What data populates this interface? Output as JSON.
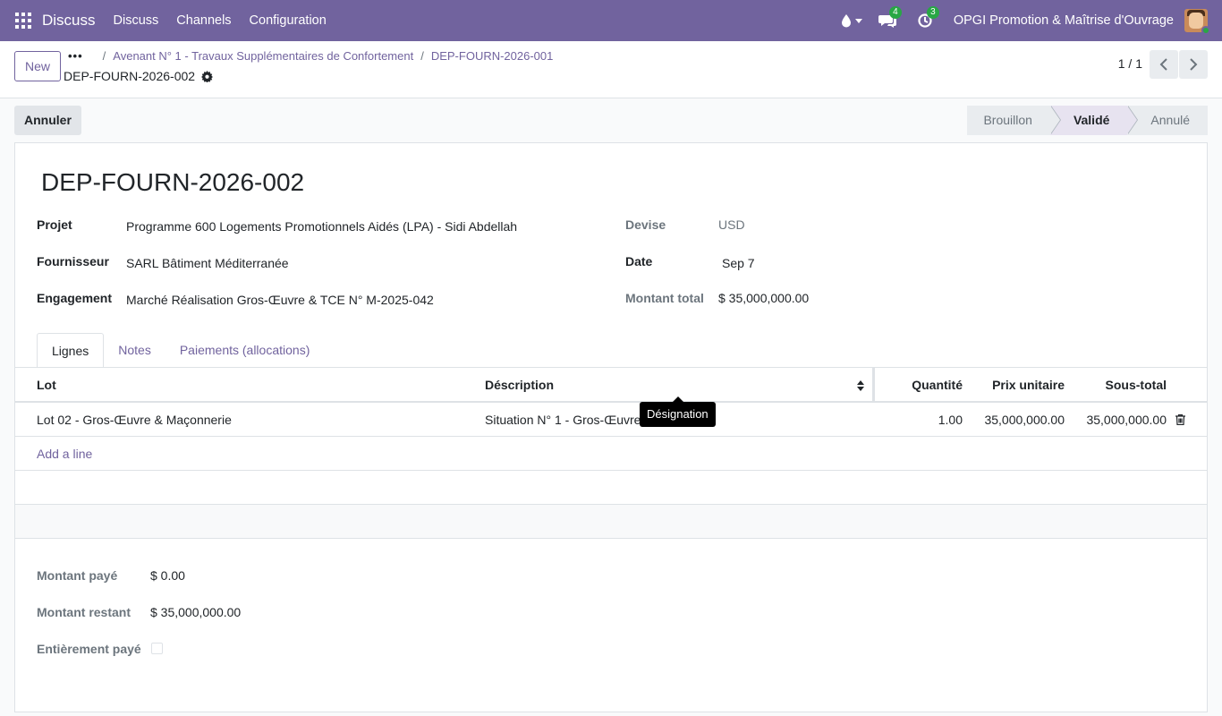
{
  "navbar": {
    "brand": "Discuss",
    "menu": [
      "Discuss",
      "Channels",
      "Configuration"
    ],
    "messages_badge": "4",
    "activities_badge": "3",
    "company": "OPGI Promotion & Maîtrise d'Ouvrage"
  },
  "control": {
    "new_label": "New",
    "breadcrumb": [
      "Avenant N° 1 - Travaux Supplémentaires de Confortement",
      "DEP-FOURN-2026-001"
    ],
    "record_name": "DEP-FOURN-2026-002",
    "pager": "1 / 1"
  },
  "statusbar": {
    "annuler_label": "Annuler",
    "stages": [
      "Brouillon",
      "Validé",
      "Annulé"
    ],
    "active_stage": "Validé"
  },
  "form": {
    "title": "DEP-FOURN-2026-002",
    "left_fields": [
      {
        "label": "Projet",
        "value": "Programme 600 Logements Promotionnels Aidés (LPA) - Sidi Abdellah"
      },
      {
        "label": "Fournisseur",
        "value": "SARL Bâtiment Méditerranée"
      },
      {
        "label": "Engagement",
        "value": "Marché Réalisation Gros-Œuvre & TCE N° M-2025-042"
      }
    ],
    "right_fields": [
      {
        "label": "Devise",
        "value": "USD"
      },
      {
        "label": "Date",
        "value": "Sep 7"
      },
      {
        "label": "Montant total",
        "value": "$ 35,000,000.00"
      }
    ],
    "tabs": [
      "Lignes",
      "Notes",
      "Paiements (allocations)"
    ]
  },
  "lines": {
    "headers": {
      "lot": "Lot",
      "description": "Déscription",
      "quantity": "Quantité",
      "unit_price": "Prix unitaire",
      "subtotal": "Sous-total"
    },
    "rows": [
      {
        "lot": "Lot 02 - Gros-Œuvre & Maçonnerie",
        "description": "Situation N° 1 - Gros-Œuvre",
        "quantity": "1.00",
        "unit_price": "35,000,000.00",
        "subtotal": "35,000,000.00"
      }
    ],
    "add_line": "Add a line",
    "tooltip": "Désignation"
  },
  "totals": {
    "paid_label": "Montant payé",
    "paid_value": "$ 0.00",
    "remaining_label": "Montant restant",
    "remaining_value": "$ 35,000,000.00",
    "fully_paid_label": "Entièrement payé",
    "fully_paid": false
  },
  "colors": {
    "brand": "#71639e",
    "badge": "#28a745"
  }
}
